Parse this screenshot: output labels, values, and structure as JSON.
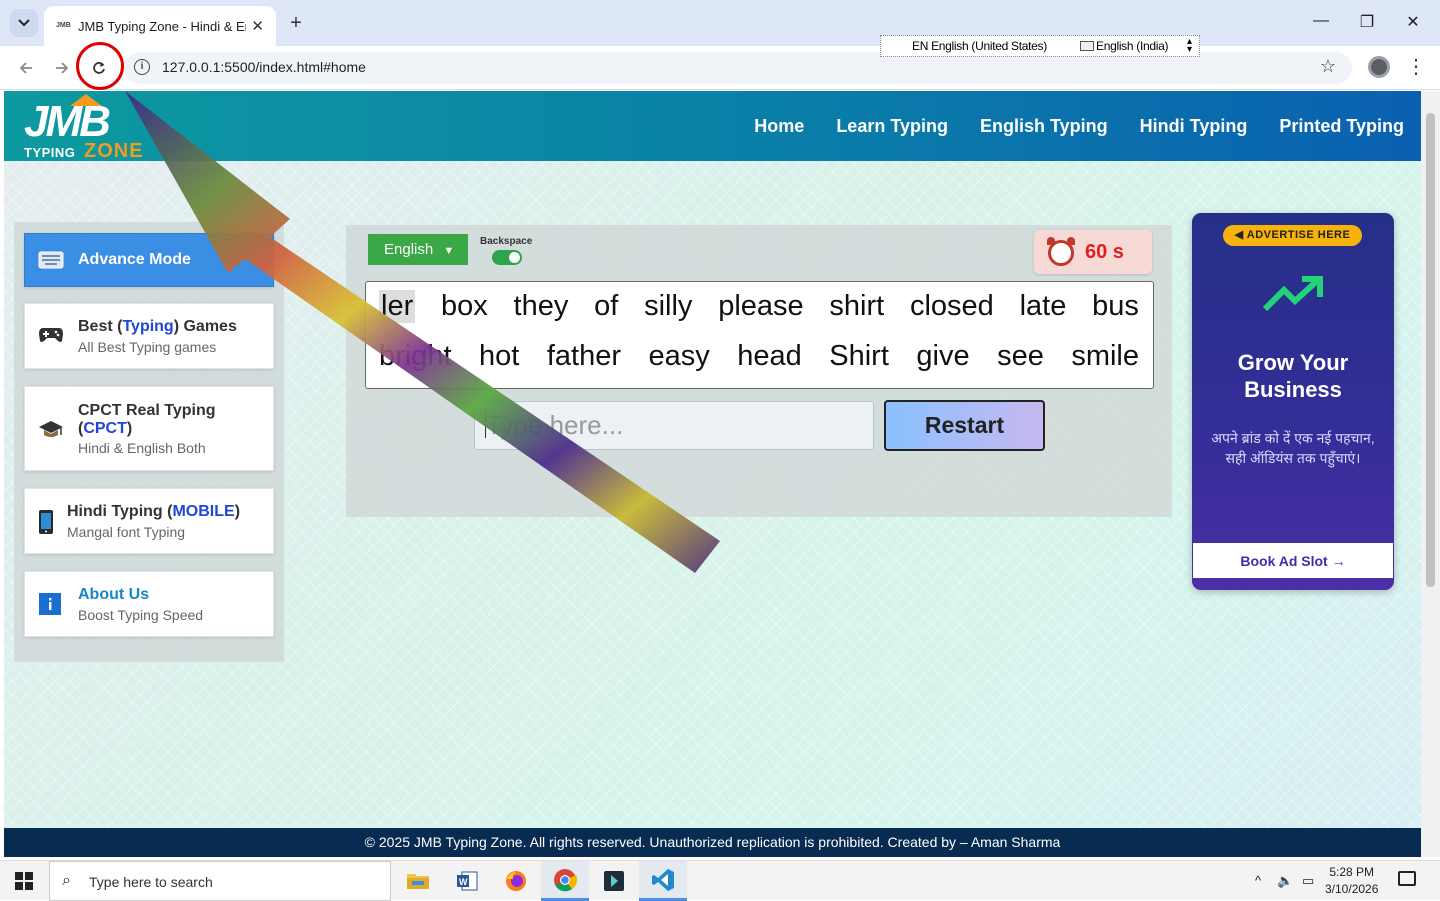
{
  "browser": {
    "tab_title": "JMB Typing Zone - Hindi & Eng",
    "tab_favicon": "JMB",
    "url": "127.0.0.1:5500/index.html#home",
    "language_bar": {
      "input_language": "EN English (United States)",
      "keyboard_layout": "English (India)"
    }
  },
  "site": {
    "logo_text": "JMB",
    "logo_sub1": "TYPING",
    "logo_sub2": "ZONE",
    "nav": [
      "Home",
      "Learn Typing",
      "English Typing",
      "Hindi Typing",
      "Printed Typing"
    ]
  },
  "sidebar": {
    "items": [
      {
        "title": "Advance Mode",
        "icon": "keyboard-icon",
        "active": true
      },
      {
        "title_prefix": "Best (",
        "title_highlight": "Typing",
        "title_suffix": ") Games",
        "subtitle": "All Best Typing games",
        "icon": "gamepad-icon"
      },
      {
        "title_prefix": "CPCT Real Typing (",
        "title_highlight": "CPCT",
        "title_suffix": ")",
        "subtitle": "Hindi & English Both",
        "icon": "graduation-cap-icon"
      },
      {
        "title_prefix": "Hindi Typing (",
        "title_highlight": "MOBILE",
        "title_suffix": ")",
        "subtitle": "Mangal font Typing",
        "icon": "mobile-icon"
      },
      {
        "title": "About Us",
        "subtitle": "Boost Typing Speed",
        "icon": "info-icon"
      }
    ]
  },
  "typing": {
    "language_label": "English",
    "backspace_label": "Backspace",
    "backspace_enabled": true,
    "timer": "60 s",
    "line1": [
      "ler",
      "box",
      "they",
      "of",
      "silly",
      "please",
      "shirt",
      "closed",
      "late",
      "bus"
    ],
    "line2": [
      "bright",
      "hot",
      "father",
      "easy",
      "head",
      "Shirt",
      "give",
      "see",
      "smile"
    ],
    "input_placeholder": "Type here...",
    "restart_label": "Restart"
  },
  "ad": {
    "badge": "ADVERTISE HERE",
    "title_line1": "Grow Your",
    "title_line2": "Business",
    "hindi_text": "अपने ब्रांड को दें एक नई पहचान, सही ऑडियंस तक पहुँचाएं।",
    "cta": "Book Ad Slot →"
  },
  "footer": {
    "text": "© 2025 JMB Typing Zone. All rights reserved. Unauthorized replication is prohibited. Created by – Aman Sharma"
  },
  "taskbar": {
    "search_placeholder": "Type here to search",
    "time": "5:28 PM",
    "date": "3/10/2026"
  },
  "colors": {
    "header_start": "#0d9a9f",
    "header_end": "#0a60b0",
    "active_sidebar": "#3a8ee3",
    "language_button": "#3aa847",
    "timer_text": "#e02020",
    "footer": "#082b52",
    "ad_bg": "#352e98",
    "highlight_circle": "#e00000"
  }
}
